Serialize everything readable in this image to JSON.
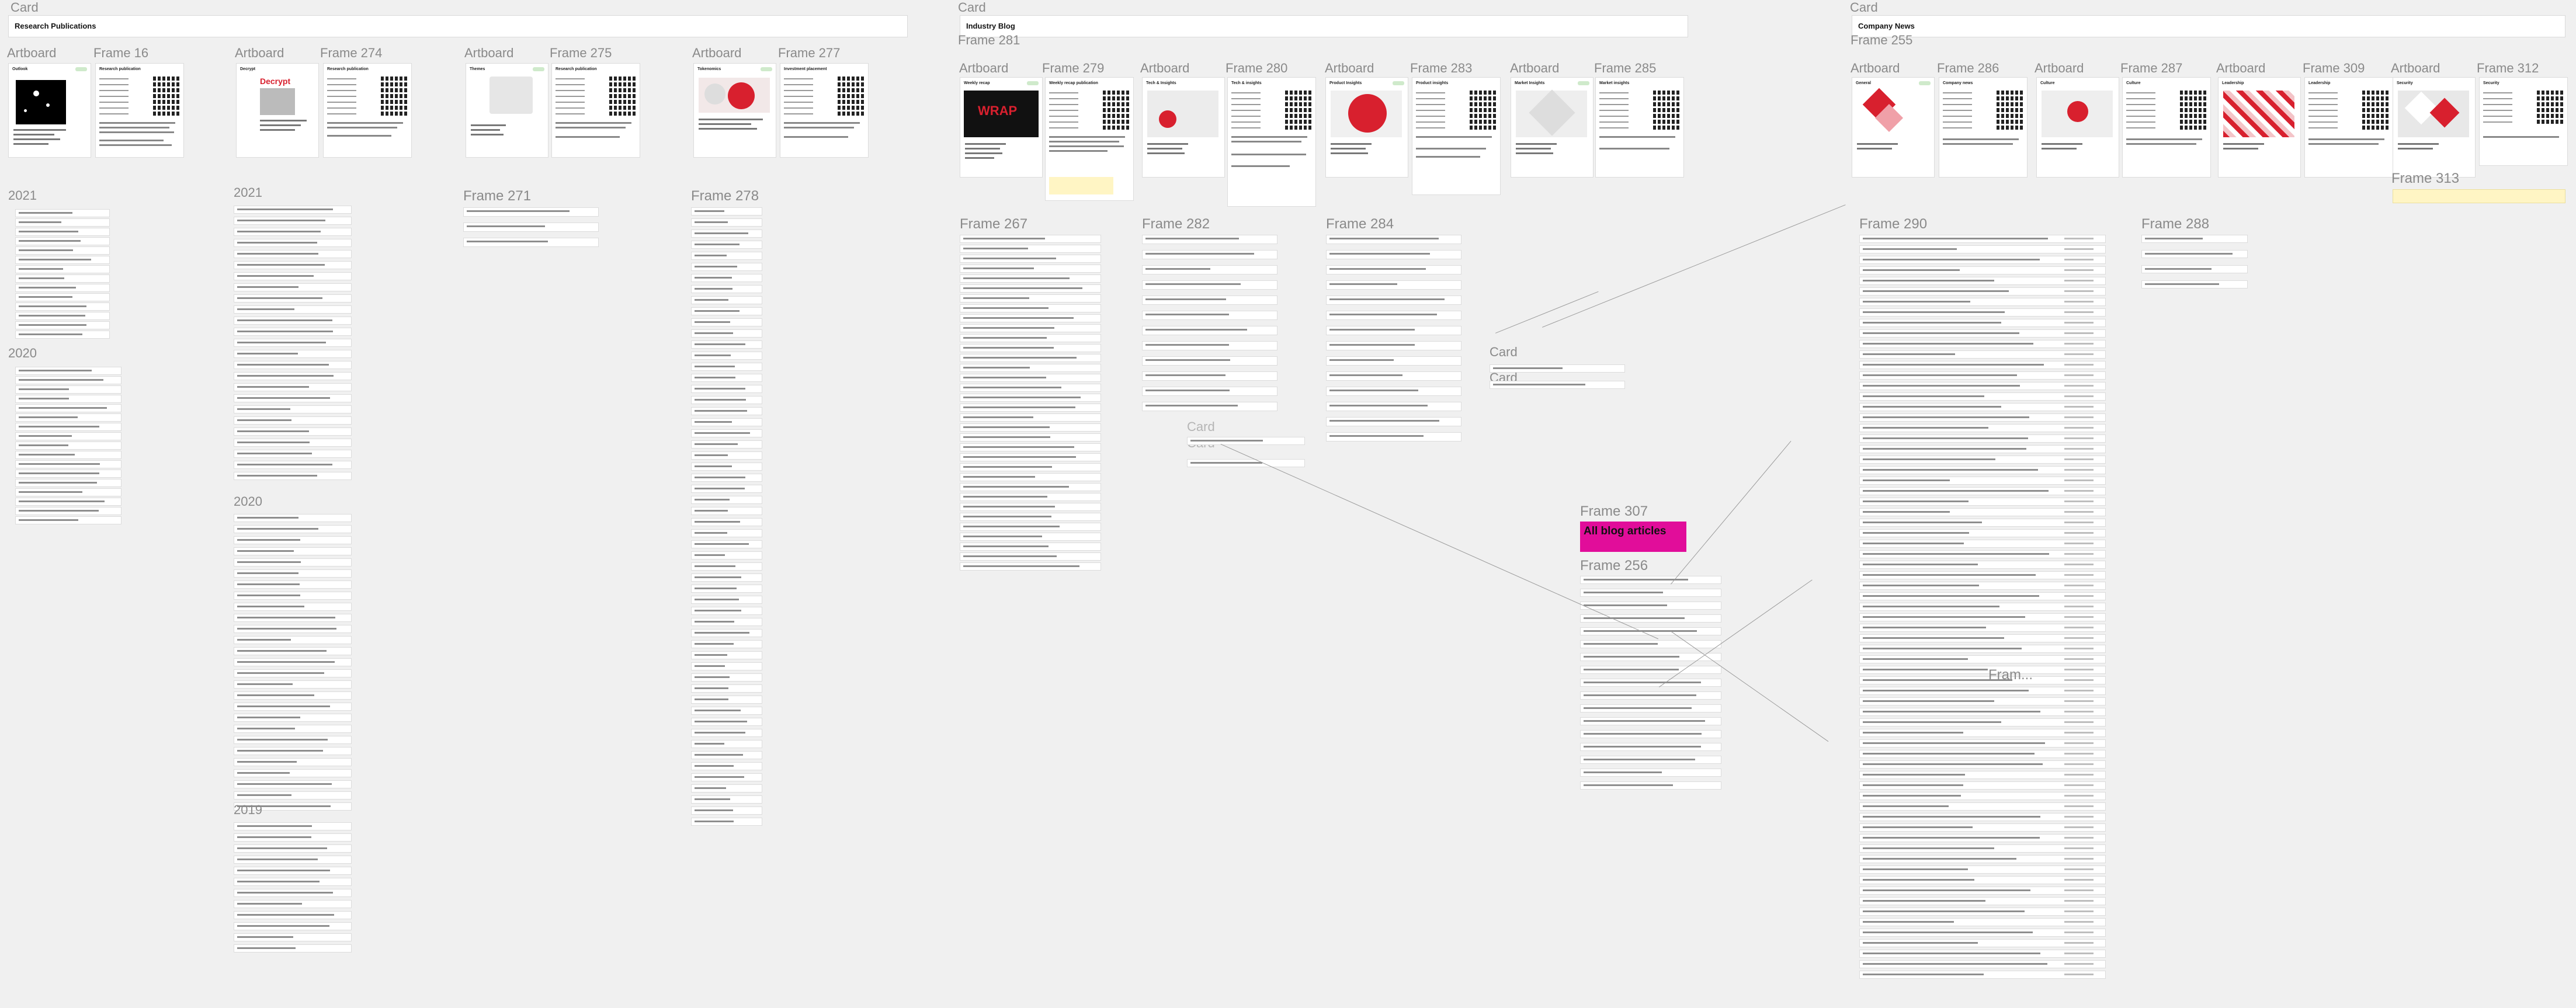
{
  "sections": {
    "research": {
      "card_label": "Card",
      "title": "Research Publications"
    },
    "industry": {
      "card_label": "Card",
      "title": "Industry Blog"
    },
    "company": {
      "card_label": "Card",
      "title": "Company News"
    }
  },
  "labels": {
    "artboard": "Artboard",
    "frame16": "Frame 16",
    "frame274": "Frame 274",
    "frame275": "Frame 275",
    "frame277": "Frame 277",
    "frame271": "Frame 271",
    "frame278": "Frame 278",
    "frame281": "Frame 281",
    "frame279": "Frame 279",
    "frame280": "Frame 280",
    "frame283": "Frame 283",
    "frame285": "Frame 285",
    "frame267": "Frame 267",
    "frame282": "Frame 282",
    "frame284": "Frame 284",
    "frame307": "Frame 307",
    "frame256": "Frame 256",
    "frame255": "Frame 255",
    "frame286": "Frame 286",
    "frame287": "Frame 287",
    "frame309": "Frame 309",
    "frame312": "Frame 312",
    "frame313": "Frame 313",
    "frame290": "Frame 290",
    "frame288": "Frame 288",
    "frame_trunc": "Fram...",
    "card": "Card",
    "card2": "Card",
    "card3": "Card"
  },
  "years": {
    "y2021a": "2021",
    "y2020a": "2020",
    "y2021b": "2021",
    "y2020b": "2020",
    "y2019": "2019"
  },
  "artboards": {
    "a1": {
      "title": "Outlook"
    },
    "a2": {
      "title": "Decrypt",
      "subtitle": "Decrypt"
    },
    "a3": {
      "title": "Themes"
    },
    "a4": {
      "title": "Tokenomics"
    },
    "i1": {
      "title": "Weekly recap",
      "img_text": "WRAP"
    },
    "i2": {
      "title": "Tech & Insights"
    },
    "i3": {
      "title": "Product Insights"
    },
    "i4": {
      "title": "Market Insights"
    },
    "c1": {
      "title": "General"
    },
    "c2": {
      "title": "Culture"
    },
    "c3": {
      "title": "Leadership"
    },
    "c4": {
      "title": "Security"
    }
  },
  "frames": {
    "f16": {
      "title": "Research publication"
    },
    "f274": {
      "title": "Research publication"
    },
    "f275": {
      "title": "Research publication"
    },
    "f277": {
      "title": "Investment placement"
    },
    "f279": {
      "title": "Weekly recap publication"
    },
    "f280": {
      "title": "Tech & insights"
    },
    "f283": {
      "title": "Product insights"
    },
    "f285": {
      "title": "Market insights"
    },
    "f286": {
      "title": "Company news"
    },
    "f287": {
      "title": "Culture"
    },
    "f309": {
      "title": "Leadership"
    },
    "f312": {
      "title": "Security"
    }
  },
  "blog": {
    "all_articles": "All blog articles"
  },
  "colors": {
    "pink": "#e10d9a",
    "red_accent": "#d8202e",
    "green_badge": "#cfeacb"
  }
}
